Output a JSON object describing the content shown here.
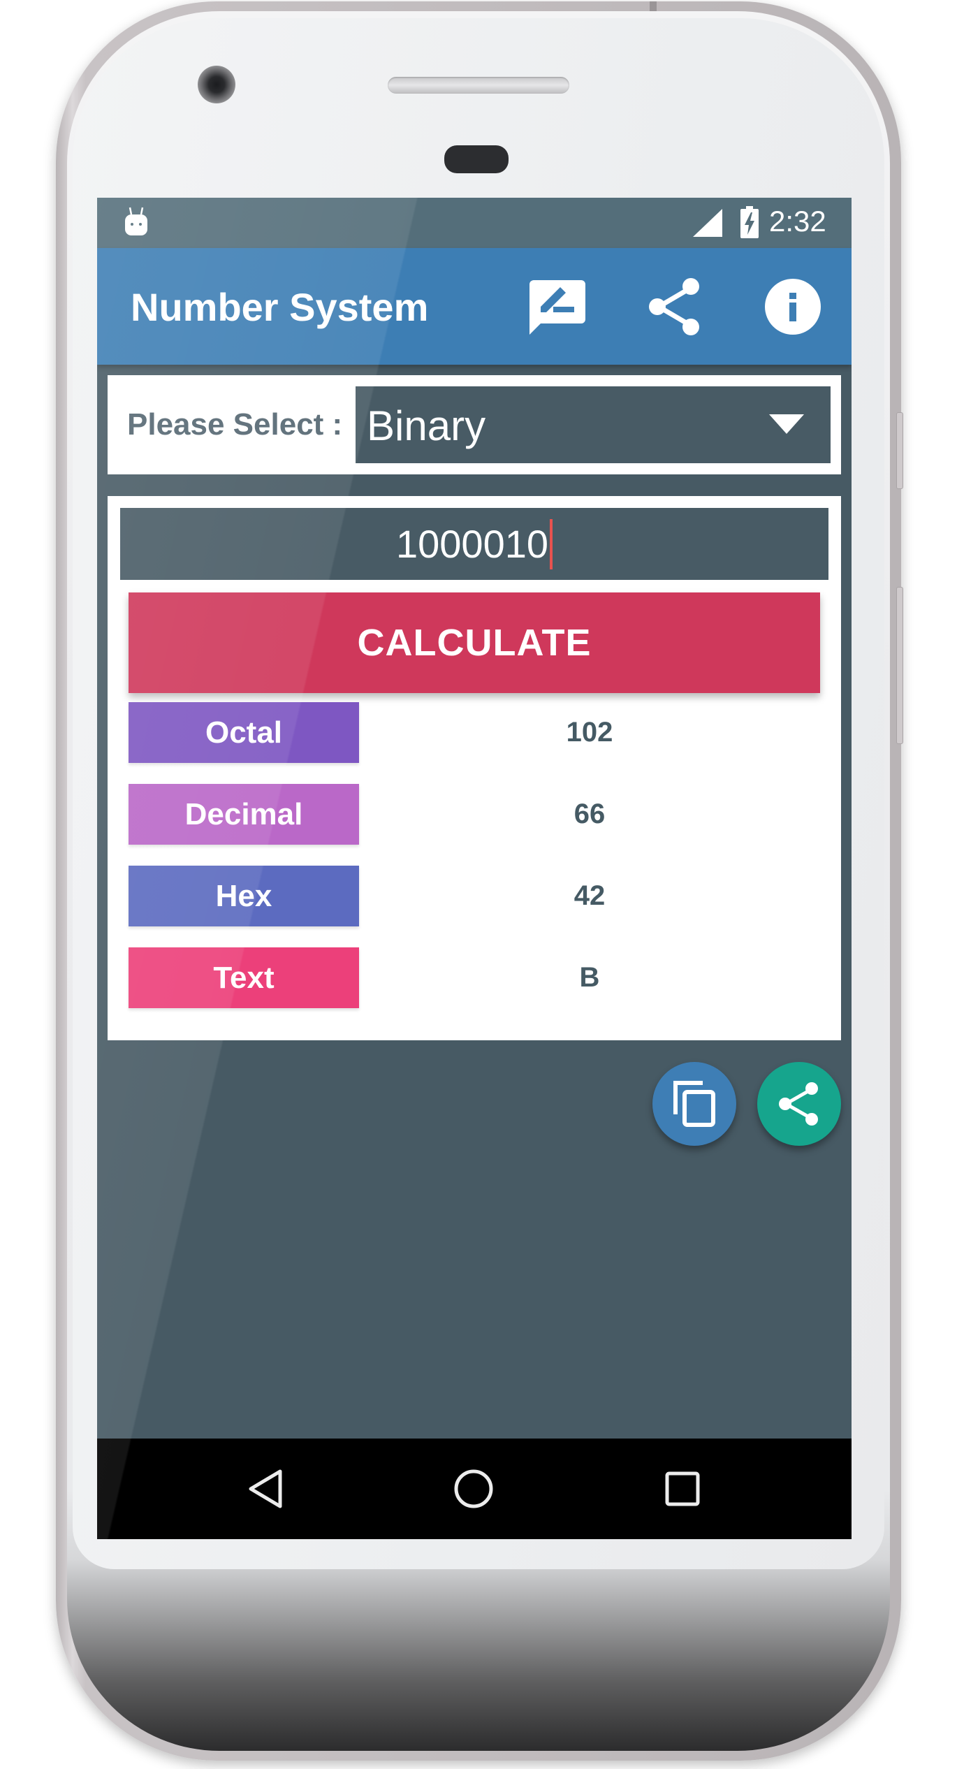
{
  "status_bar": {
    "time": "2:32",
    "icons": [
      "android-debug-icon",
      "cell-signal-icon",
      "battery-charging-icon"
    ]
  },
  "app_bar": {
    "title": "Number System",
    "actions": [
      {
        "name": "feedback",
        "icon": "rate-review-icon"
      },
      {
        "name": "share",
        "icon": "share-icon"
      },
      {
        "name": "info",
        "icon": "info-icon"
      }
    ],
    "color": "#3D7EB4"
  },
  "selector": {
    "label": "Please Select :",
    "selected": "Binary"
  },
  "input": {
    "value": "1000010"
  },
  "calculate_button": {
    "label": "CALCULATE",
    "color": "#CF385B"
  },
  "results": [
    {
      "label": "Octal",
      "value": "102",
      "color": "#7E57C2"
    },
    {
      "label": "Decimal",
      "value": "66",
      "color": "#BA68C8"
    },
    {
      "label": "Hex",
      "value": "42",
      "color": "#5C6BC0"
    },
    {
      "label": "Text",
      "value": "B",
      "color": "#EC407A"
    }
  ],
  "fabs": [
    {
      "name": "copy",
      "icon": "copy-icon",
      "color": "#3E7EB5"
    },
    {
      "name": "share",
      "icon": "share-icon",
      "color": "#16A58D"
    }
  ],
  "nav_bar": {
    "buttons": [
      "back",
      "home",
      "recents"
    ]
  }
}
